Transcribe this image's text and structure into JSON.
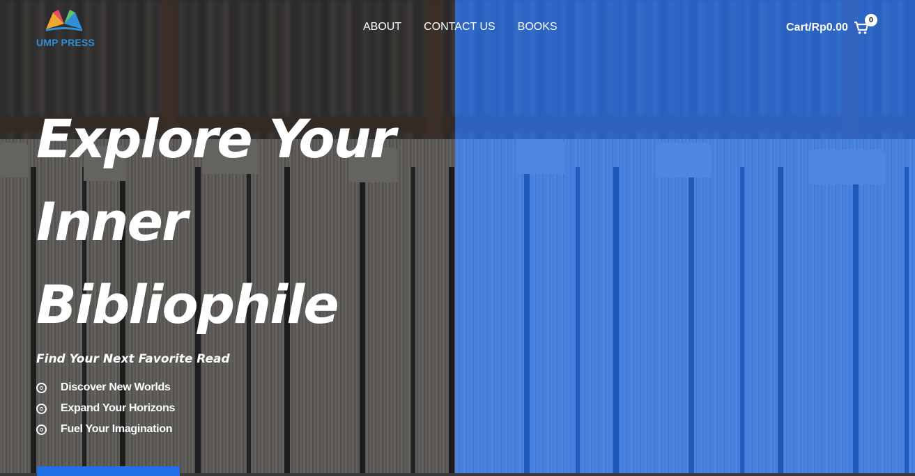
{
  "brand": {
    "name": "UMP PRESS",
    "text_color": "#2f8fd8"
  },
  "nav": {
    "items": [
      {
        "label": "ABOUT"
      },
      {
        "label": "CONTACT US"
      },
      {
        "label": "BOOKS"
      }
    ]
  },
  "cart": {
    "label": "Cart/Rp0.00",
    "count": "0",
    "icon": "cart-icon"
  },
  "hero": {
    "title_lines": [
      "Explore Your",
      "Inner",
      "Bibliophile"
    ],
    "subtitle": "Find Your Next Favorite Read",
    "features": [
      {
        "text": "Discover New Worlds",
        "icon": "ring-icon"
      },
      {
        "text": "Expand Your Horizons",
        "icon": "ring-icon"
      },
      {
        "text": "Fuel Your Imagination",
        "icon": "ring-icon"
      }
    ],
    "cta_color": "#1f6fe6"
  },
  "colors": {
    "overlay_blue": "#216ce6",
    "overlay_dark": "#202022",
    "text": "#ffffff"
  }
}
